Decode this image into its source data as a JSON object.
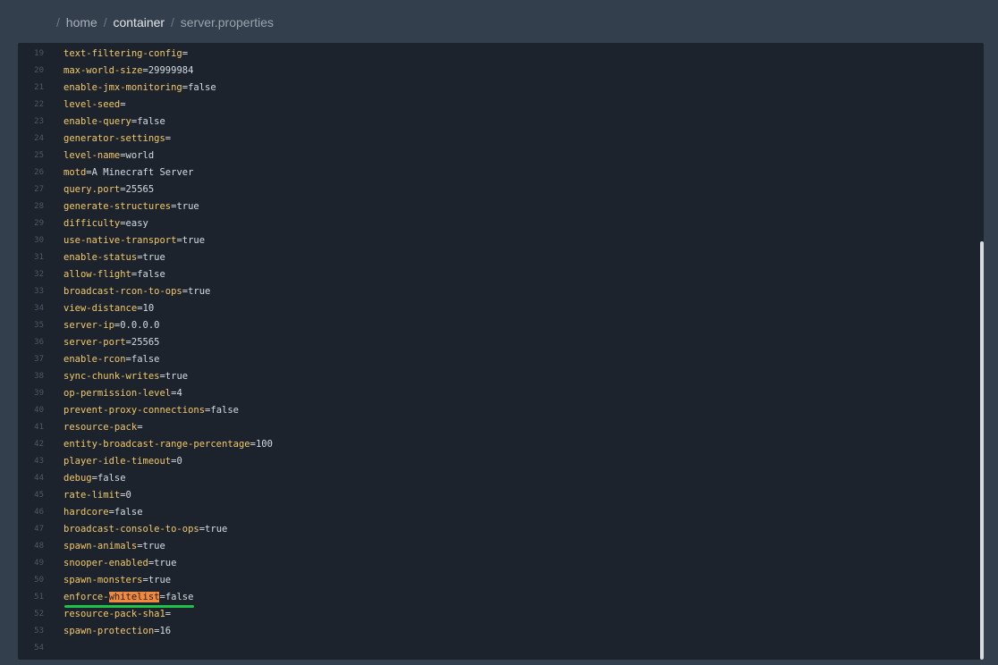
{
  "breadcrumb": {
    "separator": "/",
    "items": [
      "home",
      "container",
      "server.properties"
    ]
  },
  "editor": {
    "highlight_term": "whitelist",
    "lines": [
      {
        "num": "19",
        "key": "text-filtering-config",
        "value": ""
      },
      {
        "num": "20",
        "key": "max-world-size",
        "value": "29999984"
      },
      {
        "num": "21",
        "key": "enable-jmx-monitoring",
        "value": "false"
      },
      {
        "num": "22",
        "key": "level-seed",
        "value": ""
      },
      {
        "num": "23",
        "key": "enable-query",
        "value": "false"
      },
      {
        "num": "24",
        "key": "generator-settings",
        "value": ""
      },
      {
        "num": "25",
        "key": "level-name",
        "value": "world"
      },
      {
        "num": "26",
        "key": "motd",
        "value": "A Minecraft Server"
      },
      {
        "num": "27",
        "key": "query.port",
        "value": "25565"
      },
      {
        "num": "28",
        "key": "generate-structures",
        "value": "true"
      },
      {
        "num": "29",
        "key": "difficulty",
        "value": "easy"
      },
      {
        "num": "30",
        "key": "use-native-transport",
        "value": "true"
      },
      {
        "num": "31",
        "key": "enable-status",
        "value": "true"
      },
      {
        "num": "32",
        "key": "allow-flight",
        "value": "false"
      },
      {
        "num": "33",
        "key": "broadcast-rcon-to-ops",
        "value": "true"
      },
      {
        "num": "34",
        "key": "view-distance",
        "value": "10"
      },
      {
        "num": "35",
        "key": "server-ip",
        "value": "0.0.0.0"
      },
      {
        "num": "36",
        "key": "server-port",
        "value": "25565"
      },
      {
        "num": "37",
        "key": "enable-rcon",
        "value": "false"
      },
      {
        "num": "38",
        "key": "sync-chunk-writes",
        "value": "true"
      },
      {
        "num": "39",
        "key": "op-permission-level",
        "value": "4"
      },
      {
        "num": "40",
        "key": "prevent-proxy-connections",
        "value": "false"
      },
      {
        "num": "41",
        "key": "resource-pack",
        "value": ""
      },
      {
        "num": "42",
        "key": "entity-broadcast-range-percentage",
        "value": "100"
      },
      {
        "num": "43",
        "key": "player-idle-timeout",
        "value": "0"
      },
      {
        "num": "44",
        "key": "debug",
        "value": "false"
      },
      {
        "num": "45",
        "key": "rate-limit",
        "value": "0"
      },
      {
        "num": "46",
        "key": "hardcore",
        "value": "false"
      },
      {
        "num": "47",
        "key": "broadcast-console-to-ops",
        "value": "true"
      },
      {
        "num": "48",
        "key": "spawn-animals",
        "value": "true"
      },
      {
        "num": "49",
        "key": "snooper-enabled",
        "value": "true"
      },
      {
        "num": "50",
        "key": "spawn-monsters",
        "value": "true"
      },
      {
        "num": "51",
        "key": "enforce-whitelist",
        "value": "false"
      },
      {
        "num": "52",
        "key": "resource-pack-sha1",
        "value": ""
      },
      {
        "num": "53",
        "key": "spawn-protection",
        "value": "16"
      },
      {
        "num": "54",
        "key": "",
        "value": ""
      }
    ]
  }
}
